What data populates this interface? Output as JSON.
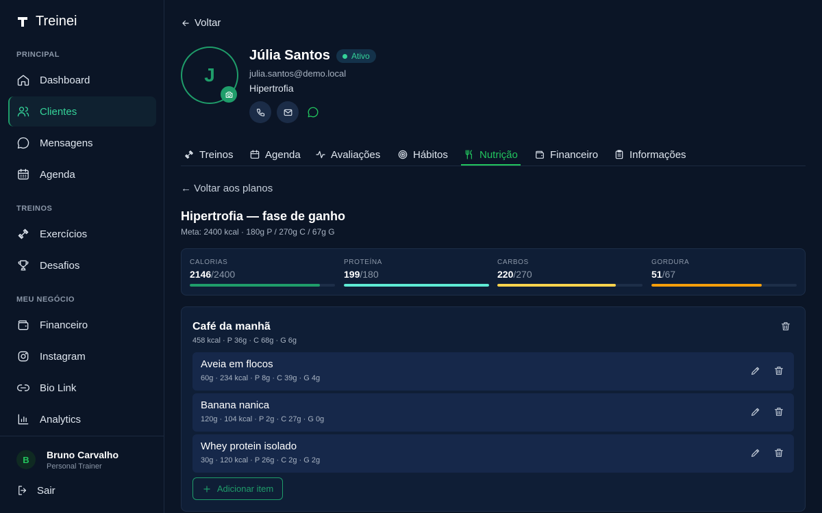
{
  "app": {
    "name": "Treinei"
  },
  "sidebar": {
    "sections": [
      {
        "label": "PRINCIPAL",
        "items": [
          {
            "label": "Dashboard",
            "icon": "home-icon"
          },
          {
            "label": "Clientes",
            "icon": "users-icon",
            "active": true
          },
          {
            "label": "Mensagens",
            "icon": "message-icon"
          },
          {
            "label": "Agenda",
            "icon": "calendar-icon"
          }
        ]
      },
      {
        "label": "TREINOS",
        "items": [
          {
            "label": "Exercícios",
            "icon": "dumbbell-icon"
          },
          {
            "label": "Desafios",
            "icon": "trophy-icon"
          }
        ]
      },
      {
        "label": "MEU NEGÓCIO",
        "items": [
          {
            "label": "Financeiro",
            "icon": "wallet-icon"
          },
          {
            "label": "Instagram",
            "icon": "instagram-icon"
          },
          {
            "label": "Bio Link",
            "icon": "link-icon"
          },
          {
            "label": "Analytics",
            "icon": "bar-chart-icon"
          }
        ]
      }
    ],
    "user": {
      "initial": "B",
      "name": "Bruno Carvalho",
      "role": "Personal Trainer"
    },
    "logout_label": "Sair"
  },
  "main": {
    "back_label": "Voltar",
    "client": {
      "initial": "J",
      "name": "Júlia Santos",
      "status": "Ativo",
      "email": "julia.santos@demo.local",
      "goal": "Hipertrofia"
    },
    "tabs": [
      {
        "label": "Treinos",
        "icon": "dumbbell-icon"
      },
      {
        "label": "Agenda",
        "icon": "calendar-icon"
      },
      {
        "label": "Avaliações",
        "icon": "activity-icon"
      },
      {
        "label": "Hábitos",
        "icon": "target-icon"
      },
      {
        "label": "Nutrição",
        "icon": "utensils-icon",
        "active": true
      },
      {
        "label": "Financeiro",
        "icon": "wallet-icon"
      },
      {
        "label": "Informações",
        "icon": "clipboard-icon"
      }
    ],
    "back_plans_label": "← Voltar aos planos",
    "plan": {
      "title": "Hipertrofia — fase de ganho",
      "meta": "Meta: 2400 kcal · 180g P / 270g C / 67g G"
    },
    "macros": [
      {
        "label": "CALORIAS",
        "current": "2146",
        "target": "/2400",
        "progress": 0.894,
        "color": "#1f9d6a"
      },
      {
        "label": "PROTEÍNA",
        "current": "199",
        "target": "/180",
        "progress": 1.0,
        "color": "#5eead4"
      },
      {
        "label": "CARBOS",
        "current": "220",
        "target": "/270",
        "progress": 0.815,
        "color": "#fcd34d"
      },
      {
        "label": "GORDURA",
        "current": "51",
        "target": "/67",
        "progress": 0.761,
        "color": "#f59e0b"
      }
    ],
    "meal": {
      "title": "Café da manhã",
      "meta": "458 kcal · P 36g · C 68g · G 6g",
      "items": [
        {
          "name": "Aveia em flocos",
          "meta": "60g · 234 kcal · P 8g · C 39g · G 4g"
        },
        {
          "name": "Banana nanica",
          "meta": "120g · 104 kcal · P 2g · C 27g · G 0g"
        },
        {
          "name": "Whey protein isolado",
          "meta": "30g · 120 kcal · P 26g · C 2g · G 2g"
        }
      ],
      "add_label": "Adicionar item"
    }
  }
}
